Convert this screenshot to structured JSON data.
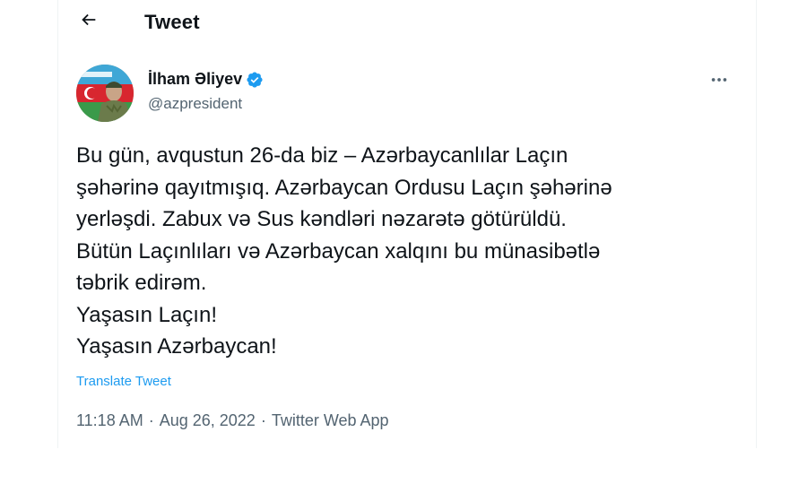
{
  "header": {
    "title": "Tweet",
    "back_icon": "arrow-left-icon"
  },
  "author": {
    "name": "İlham Əliyev",
    "handle": "@azpresident",
    "verified": true,
    "verified_color": "#1d9bf0"
  },
  "tweet": {
    "lines": [
      "Bu gün, avqustun 26-da biz – Azərbaycanlılar Laçın",
      "şəhərinə qayıtmışıq. Azərbaycan Ordusu Laçın şəhərinə",
      "yerləşdi. Zabux və Sus kəndləri nəzarətə götürüldü.",
      "Bütün Laçınlıları və Azərbaycan xalqını bu münasibətlə",
      "təbrik edirəm.",
      "Yaşasın Laçın!",
      "Yaşasın Azərbaycan!"
    ],
    "translate_label": "Translate Tweet",
    "time": "11:18 AM",
    "date": "Aug 26, 2022",
    "source": "Twitter Web App",
    "separator": "·"
  },
  "colors": {
    "accent": "#1d9bf0",
    "secondary_text": "#536471",
    "primary_text": "#0f1419"
  }
}
